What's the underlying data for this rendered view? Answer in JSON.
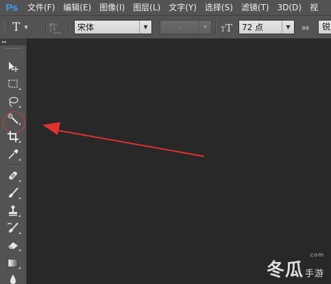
{
  "app": {
    "logo": "Ps"
  },
  "menu": [
    "文件(F)",
    "编辑(E)",
    "图像(I)",
    "图层(L)",
    "文字(Y)",
    "选择(S)",
    "滤镜(T)",
    "3D(D)",
    "视"
  ],
  "options": {
    "tool_glyph": "T",
    "font_family": "宋体",
    "font_style": "-",
    "font_size": "72 点",
    "antialias_icon_label": "aa",
    "antialias_value": "锐"
  },
  "toolbox": {
    "header": "▸▸",
    "tools": [
      {
        "name": "move-tool",
        "icon": "move-icon"
      },
      {
        "name": "marquee-tool",
        "icon": "rect-marquee-icon"
      },
      {
        "name": "lasso-tool",
        "icon": "lasso-icon"
      },
      {
        "name": "magic-wand-tool",
        "icon": "magic-wand-icon"
      },
      {
        "name": "crop-tool",
        "icon": "crop-icon"
      },
      {
        "name": "eyedropper-tool",
        "icon": "eyedropper-icon"
      },
      {
        "name": "healing-brush-tool",
        "icon": "bandage-icon"
      },
      {
        "name": "brush-tool",
        "icon": "brush-icon"
      },
      {
        "name": "clone-stamp-tool",
        "icon": "stamp-icon"
      },
      {
        "name": "history-brush-tool",
        "icon": "history-brush-icon"
      },
      {
        "name": "eraser-tool",
        "icon": "eraser-icon"
      },
      {
        "name": "gradient-tool",
        "icon": "gradient-icon"
      },
      {
        "name": "blur-tool",
        "icon": "drop-icon"
      }
    ]
  },
  "annotation": {
    "color": "#e03030"
  },
  "watermark": {
    "text": "冬瓜",
    "sub": "手游",
    "url": "com"
  }
}
